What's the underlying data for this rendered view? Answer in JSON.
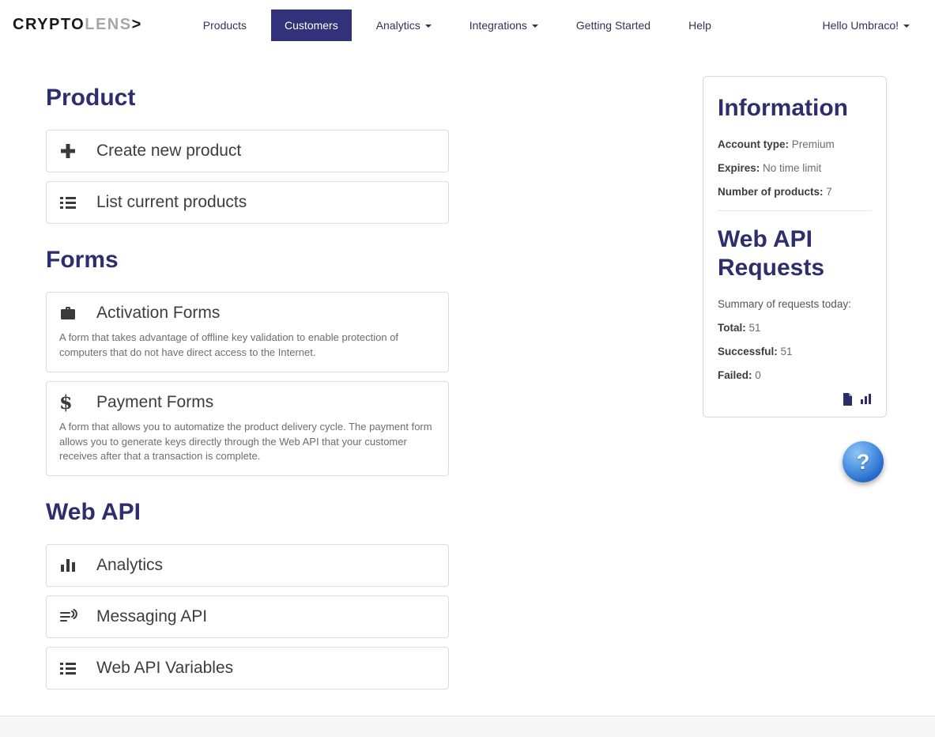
{
  "brand": {
    "bold": "CRYPTO",
    "light": "LENS",
    "arrow": ">"
  },
  "nav": {
    "items": [
      {
        "label": "Products"
      },
      {
        "label": "Customers"
      },
      {
        "label": "Analytics"
      },
      {
        "label": "Integrations"
      },
      {
        "label": "Getting Started"
      },
      {
        "label": "Help"
      }
    ],
    "user_menu": {
      "label": "Hello Umbraco!"
    }
  },
  "sections": {
    "product": {
      "title": "Product",
      "panels": [
        {
          "title": "Create new product",
          "icon": "plus-icon"
        },
        {
          "title": "List current products",
          "icon": "list-icon"
        }
      ]
    },
    "forms": {
      "title": "Forms",
      "panels": [
        {
          "title": "Activation Forms",
          "icon": "briefcase-icon",
          "description": "A form that takes advantage of offline key validation to enable protection of computers that do not have direct access to the Internet."
        },
        {
          "title": "Payment Forms",
          "icon": "dollar-icon",
          "description": "A form that allows you to automatize the product delivery cycle. The payment form allows you to generate keys directly through the Web API that your customer receives after that a transaction is complete."
        }
      ]
    },
    "web_api": {
      "title": "Web API",
      "panels": [
        {
          "title": "Analytics",
          "icon": "bar-chart-icon"
        },
        {
          "title": "Messaging API",
          "icon": "messaging-icon"
        },
        {
          "title": "Web API Variables",
          "icon": "list-icon"
        }
      ]
    }
  },
  "info_card": {
    "information": {
      "title": "Information",
      "rows": [
        {
          "label": "Account type:",
          "value": "Premium"
        },
        {
          "label": "Expires:",
          "value": "No time limit"
        },
        {
          "label": "Number of products:",
          "value": "7"
        }
      ]
    },
    "requests": {
      "title": "Web API Requests",
      "summary": "Summary of requests today:",
      "rows": [
        {
          "label": "Total:",
          "value": "51"
        },
        {
          "label": "Successful:",
          "value": "51"
        },
        {
          "label": "Failed:",
          "value": "0"
        }
      ]
    },
    "icons": [
      "report-doc-icon",
      "chart-icon"
    ]
  },
  "glyphs": {
    "dollar": "$"
  },
  "help_button": {
    "label": "?"
  },
  "colors": {
    "accent": "#2e2e6e",
    "nav_active_bg": "#32327a"
  }
}
